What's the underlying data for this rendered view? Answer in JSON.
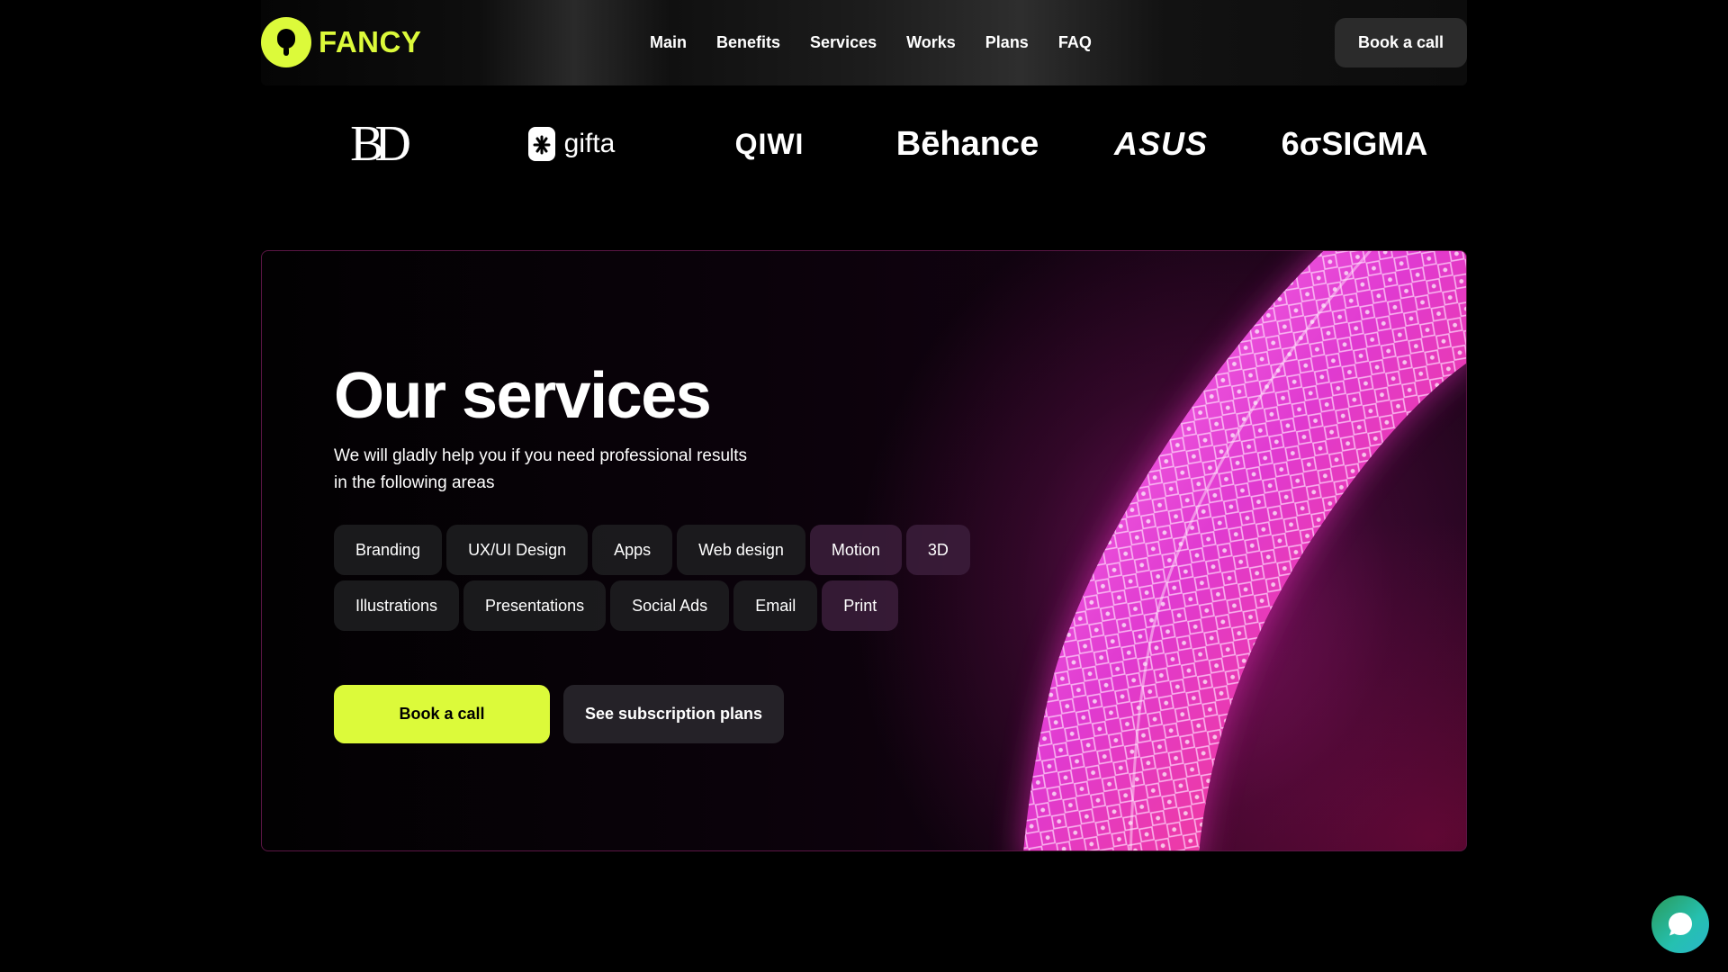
{
  "header": {
    "logo_text": "FANCY",
    "nav": [
      "Main",
      "Benefits",
      "Services",
      "Works",
      "Plans",
      "FAQ"
    ],
    "cta_label": "Book a call"
  },
  "partners": [
    {
      "name": "BD",
      "icon": "bd-logo"
    },
    {
      "name": "gifta",
      "icon": "gifta-logo"
    },
    {
      "name": "QIWI",
      "icon": "qiwi-logo"
    },
    {
      "name": "Bēhance",
      "icon": "behance-logo"
    },
    {
      "name": "ASUS",
      "icon": "asus-logo"
    },
    {
      "name": "6σSIGMA",
      "icon": "sixsigma-logo"
    }
  ],
  "services": {
    "title": "Our services",
    "subtitle_line1": "We will gladly help you if you need professional results",
    "subtitle_line2": "in the following areas",
    "tags_row1": [
      "Branding",
      "UX/UI Design",
      "Apps",
      "Web design",
      "Motion",
      "3D"
    ],
    "tags_row2": [
      "Illustrations",
      "Presentations",
      "Social Ads",
      "Email",
      "Print"
    ],
    "primary_cta": "Book a call",
    "secondary_cta": "See subscription plans"
  },
  "colors": {
    "accent": "#dcfa3a",
    "background": "#000000",
    "glow": "#e040c8",
    "chat": "#25c0b0"
  },
  "chat": {
    "icon": "chat-bubble-icon"
  }
}
